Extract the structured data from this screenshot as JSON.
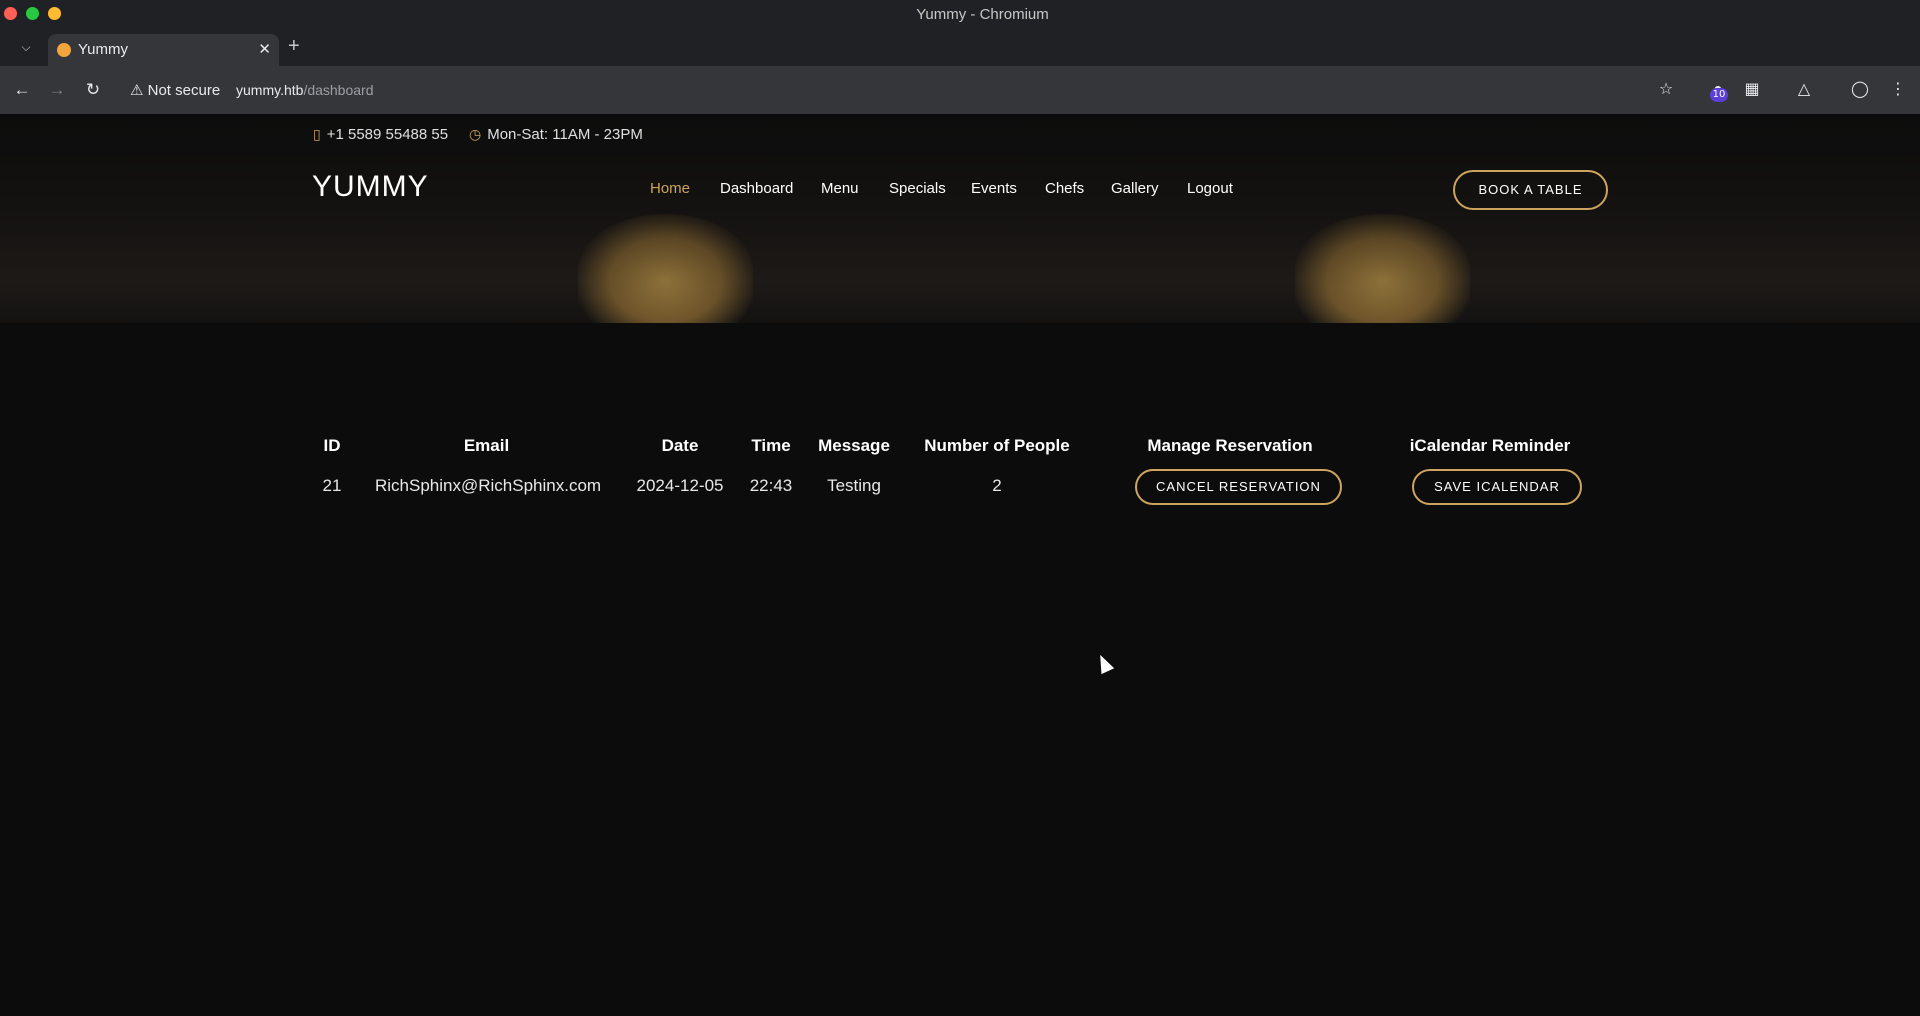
{
  "window": {
    "title": "Yummy - Chromium"
  },
  "tabs": [
    {
      "label": "Yummy"
    }
  ],
  "addressbar": {
    "security_label": "Not secure",
    "host": "yummy.htb",
    "path": "/dashboard"
  },
  "extensions": {
    "badge_count": "10"
  },
  "topbar": {
    "phone": "+1 5589 55488 55",
    "hours": "Mon-Sat: 11AM - 23PM"
  },
  "site": {
    "logo": "YUMMY",
    "nav": [
      "Home",
      "Dashboard",
      "Menu",
      "Specials",
      "Events",
      "Chefs",
      "Gallery",
      "Logout"
    ],
    "active_nav": "Home",
    "book_button": "BOOK A TABLE"
  },
  "reservations": {
    "headers": [
      "ID",
      "Email",
      "Date",
      "Time",
      "Message",
      "Number of People",
      "Manage Reservation",
      "iCalendar Reminder"
    ],
    "rows": [
      {
        "id": "21",
        "email": "RichSphinx@RichSphinx.com",
        "date": "2024-12-05",
        "time": "22:43",
        "message": "Testing",
        "people": "2",
        "cancel_label": "CANCEL RESERVATION",
        "ical_label": "SAVE ICALENDAR"
      }
    ]
  },
  "colors": {
    "accent": "#cda45e",
    "background": "#0c0c0c",
    "chrome": "#35363a"
  }
}
